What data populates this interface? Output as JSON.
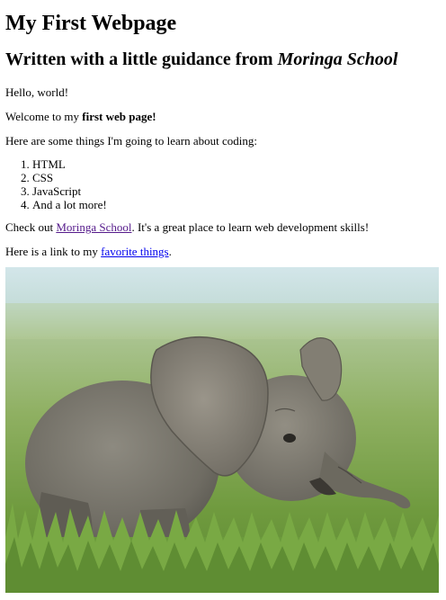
{
  "page": {
    "title": "My First Webpage",
    "subtitle_prefix": "Written with a little guidance from ",
    "subtitle_school": "Moringa School",
    "hello": "Hello, world!",
    "welcome_prefix": "Welcome to my ",
    "welcome_bold": "first web page!",
    "things_intro": "Here are some things I'm going to learn about coding:",
    "learn_list": [
      "HTML",
      "CSS",
      "JavaScript",
      "And a lot more!"
    ],
    "checkout_prefix": "Check out ",
    "checkout_link": "Moringa School",
    "checkout_suffix": ". It's a great place to learn web development skills!",
    "favorites_prefix": "Here is a link to my ",
    "favorites_link": "favorite things",
    "favorites_suffix": "."
  },
  "image": {
    "subject": "baby-elephant-photo",
    "colors": {
      "sky": "#cfe3e8",
      "field_far": "#9fb87a",
      "grass": "#6f9a3e",
      "grass_dark": "#4f7a2a",
      "elephant": "#7d7a70",
      "elephant_dark": "#5a574f",
      "ear": "#8a8579"
    }
  }
}
